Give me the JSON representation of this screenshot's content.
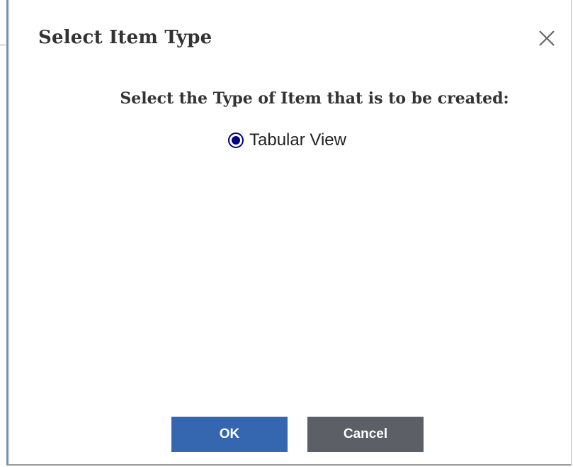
{
  "dialog": {
    "title": "Select Item Type",
    "close_icon": "close-icon",
    "prompt": "Select the Type of Item that is to be created:",
    "options": [
      {
        "label": "Tabular View",
        "selected": true
      }
    ],
    "buttons": {
      "ok_label": "OK",
      "cancel_label": "Cancel"
    }
  },
  "colors": {
    "ok_button": "#3567b1",
    "cancel_button": "#5c5f66",
    "radio": "#000080",
    "dialog_accent_border": "#6f8fb7",
    "text": "#333333"
  }
}
